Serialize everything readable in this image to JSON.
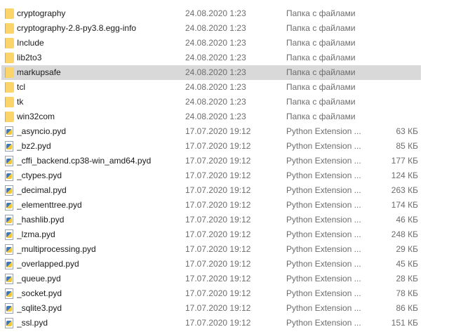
{
  "rows": [
    {
      "name": "cryptography",
      "date": "24.08.2020 1:23",
      "type": "Папка с файлами",
      "size": "",
      "icon": "folder-icon"
    },
    {
      "name": "cryptography-2.8-py3.8.egg-info",
      "date": "24.08.2020 1:23",
      "type": "Папка с файлами",
      "size": "",
      "icon": "folder-icon"
    },
    {
      "name": "Include",
      "date": "24.08.2020 1:23",
      "type": "Папка с файлами",
      "size": "",
      "icon": "folder-icon"
    },
    {
      "name": "lib2to3",
      "date": "24.08.2020 1:23",
      "type": "Папка с файлами",
      "size": "",
      "icon": "folder-icon"
    },
    {
      "name": "markupsafe",
      "date": "24.08.2020 1:23",
      "type": "Папка с файлами",
      "size": "",
      "icon": "folder-icon",
      "selected": true
    },
    {
      "name": "tcl",
      "date": "24.08.2020 1:23",
      "type": "Папка с файлами",
      "size": "",
      "icon": "folder-icon"
    },
    {
      "name": "tk",
      "date": "24.08.2020 1:23",
      "type": "Папка с файлами",
      "size": "",
      "icon": "folder-icon"
    },
    {
      "name": "win32com",
      "date": "24.08.2020 1:23",
      "type": "Папка с файлами",
      "size": "",
      "icon": "folder-icon"
    },
    {
      "name": "_asyncio.pyd",
      "date": "17.07.2020 19:12",
      "type": "Python Extension ...",
      "size": "63 КБ",
      "icon": "pyd-icon"
    },
    {
      "name": "_bz2.pyd",
      "date": "17.07.2020 19:12",
      "type": "Python Extension ...",
      "size": "85 КБ",
      "icon": "pyd-icon"
    },
    {
      "name": "_cffi_backend.cp38-win_amd64.pyd",
      "date": "17.07.2020 19:12",
      "type": "Python Extension ...",
      "size": "177 КБ",
      "icon": "pyd-icon"
    },
    {
      "name": "_ctypes.pyd",
      "date": "17.07.2020 19:12",
      "type": "Python Extension ...",
      "size": "124 КБ",
      "icon": "pyd-icon"
    },
    {
      "name": "_decimal.pyd",
      "date": "17.07.2020 19:12",
      "type": "Python Extension ...",
      "size": "263 КБ",
      "icon": "pyd-icon"
    },
    {
      "name": "_elementtree.pyd",
      "date": "17.07.2020 19:12",
      "type": "Python Extension ...",
      "size": "174 КБ",
      "icon": "pyd-icon"
    },
    {
      "name": "_hashlib.pyd",
      "date": "17.07.2020 19:12",
      "type": "Python Extension ...",
      "size": "46 КБ",
      "icon": "pyd-icon"
    },
    {
      "name": "_lzma.pyd",
      "date": "17.07.2020 19:12",
      "type": "Python Extension ...",
      "size": "248 КБ",
      "icon": "pyd-icon"
    },
    {
      "name": "_multiprocessing.pyd",
      "date": "17.07.2020 19:12",
      "type": "Python Extension ...",
      "size": "29 КБ",
      "icon": "pyd-icon"
    },
    {
      "name": "_overlapped.pyd",
      "date": "17.07.2020 19:12",
      "type": "Python Extension ...",
      "size": "45 КБ",
      "icon": "pyd-icon"
    },
    {
      "name": "_queue.pyd",
      "date": "17.07.2020 19:12",
      "type": "Python Extension ...",
      "size": "28 КБ",
      "icon": "pyd-icon"
    },
    {
      "name": "_socket.pyd",
      "date": "17.07.2020 19:12",
      "type": "Python Extension ...",
      "size": "78 КБ",
      "icon": "pyd-icon"
    },
    {
      "name": "_sqlite3.pyd",
      "date": "17.07.2020 19:12",
      "type": "Python Extension ...",
      "size": "86 КБ",
      "icon": "pyd-icon"
    },
    {
      "name": "_ssl.pyd",
      "date": "17.07.2020 19:12",
      "type": "Python Extension ...",
      "size": "151 КБ",
      "icon": "pyd-icon"
    }
  ],
  "colors": {
    "selected_row_bg": "#d9d9d9",
    "secondary_text": "#6d6d6d",
    "folder": "#fcd56a"
  }
}
